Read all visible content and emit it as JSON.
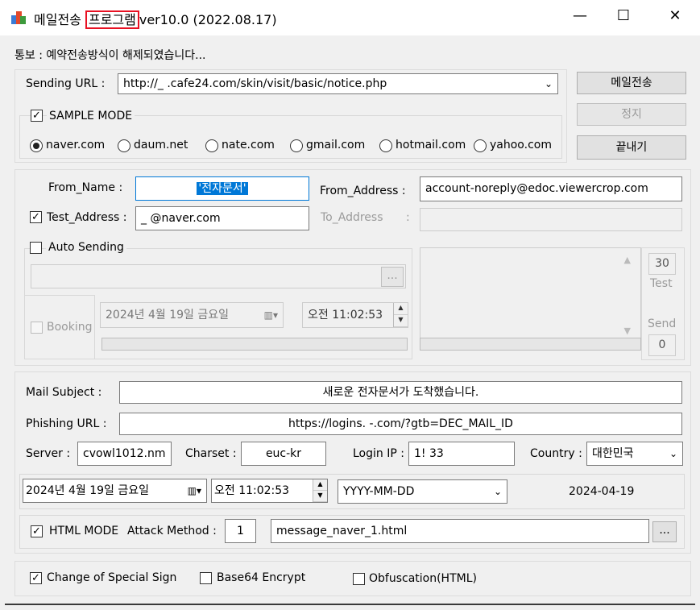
{
  "window": {
    "title_prefix": "메일전송 ",
    "title_highlight": "프로그램",
    "title_suffix": "ver10.0 (2022.08.17)",
    "minimize": "—",
    "maximize": "☐",
    "close": "✕"
  },
  "notice": "통보 : 예약전송방식이 해제되였습니다...",
  "sending": {
    "label": "Sending URL  :",
    "url": "http://_              .cafe24.com/skin/visit/basic/notice.php"
  },
  "buttons": {
    "send": "메일전송",
    "stop": "정지",
    "exit": "끝내기",
    "browse": "..."
  },
  "sample_mode": {
    "label": "SAMPLE MODE",
    "checked": true,
    "options": [
      "naver.com",
      "daum.net",
      "nate.com",
      "gmail.com",
      "hotmail.com",
      "yahoo.com"
    ],
    "selected": "naver.com"
  },
  "sender": {
    "from_name_label": "From_Name   :",
    "from_name_value": "'전자문서'",
    "from_address_label": "From_Address  :",
    "from_address_value": "account-noreply@edoc.viewercrop.com",
    "test_address_label": "Test_Address :",
    "test_address_value": "_              @naver.com",
    "to_address_label": "To_Address",
    "to_address_colon": ":",
    "auto_sending_label": "Auto Sending",
    "booking_label": "Booking",
    "booking_date": "2024년  4월 19일 금요일",
    "booking_time": "오전 11:02:53",
    "count_value": "30",
    "test_label": "Test",
    "send_label": "Send",
    "send_value": "0"
  },
  "mail": {
    "subject_label": "Mail Subject  :",
    "subject_value": "새로운 전자문서가 도착했습니다.",
    "phishing_label": "Phishing URL  :",
    "phishing_value": "https://logins.                    -.com/?gtb=DEC_MAIL_ID",
    "server_label": "Server :",
    "server_value": "cvowl1012.nm",
    "charset_label": "Charset :",
    "charset_value": "euc-kr",
    "login_ip_label": "Login IP :",
    "login_ip_value": "1!                 33",
    "country_label": "Country :",
    "country_value": "대한민국",
    "date_value": "2024년  4월 19일 금요일",
    "time_value": "오전 11:02:53",
    "format_value": "YYYY-MM-DD",
    "date_display": "2024-04-19",
    "html_mode_label": "HTML MODE",
    "attack_label": "Attack Method :",
    "attack_value": "1",
    "html_file": "message_naver_1.html"
  },
  "options": {
    "special_sign": "Change of Special Sign",
    "base64": "Base64 Encrypt",
    "obfuscation": "Obfuscation(HTML)"
  }
}
